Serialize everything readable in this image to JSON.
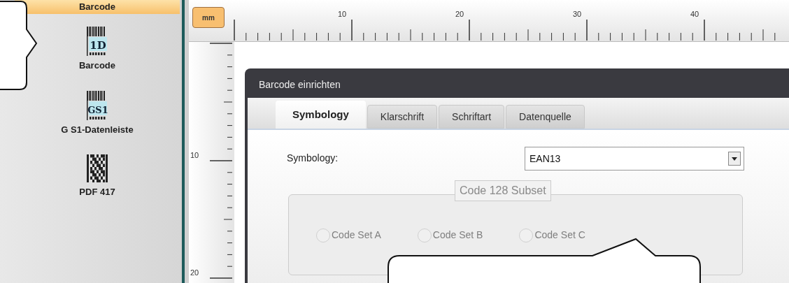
{
  "sidebar": {
    "header": "Barcode",
    "items": [
      {
        "kind": "linear",
        "icon_text": "1D",
        "label": "Barcode"
      },
      {
        "kind": "databar",
        "icon_text": "GS1",
        "label": "G S1-Datenleiste"
      },
      {
        "kind": "stacked",
        "label": "PDF 417"
      }
    ]
  },
  "ruler": {
    "unit": "mm",
    "top_labels": [
      "10",
      "20",
      "30",
      "40"
    ],
    "left_labels": [
      "10",
      "20"
    ]
  },
  "dialog": {
    "title": "Barcode einrichten",
    "tabs": [
      {
        "label": "Symbology",
        "selected": true
      },
      {
        "label": "Klarschrift",
        "selected": false
      },
      {
        "label": "Schriftart",
        "selected": false
      },
      {
        "label": "Datenquelle",
        "selected": false
      }
    ],
    "symbology": {
      "label": "Symbology:",
      "value": "EAN13"
    },
    "group": {
      "legend": "Code 128 Subset",
      "disabled": true,
      "options": [
        {
          "label": "Code Set A",
          "selected": false
        },
        {
          "label": "Code Set B",
          "selected": false
        },
        {
          "label": "Code Set C",
          "selected": false
        }
      ]
    }
  }
}
